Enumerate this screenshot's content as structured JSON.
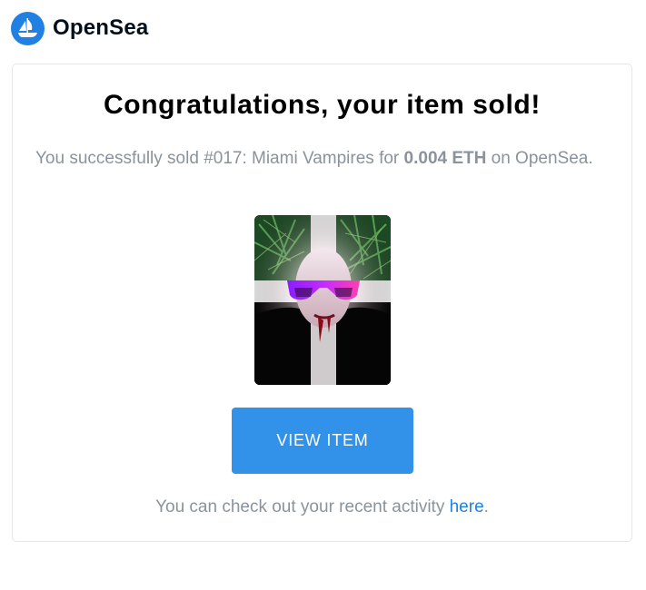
{
  "brand": {
    "name": "OpenSea",
    "icon": "opensea-logo-icon",
    "color": "#2081E2"
  },
  "email": {
    "title": "Congratulations, your item sold!",
    "message_prefix": "You successfully sold ",
    "item_name": "#017: Miami Vampires",
    "message_middle": " for ",
    "price": "0.004 ETH",
    "message_suffix": " on OpenSea.",
    "image_icon": "nft-artwork-miami-vampire",
    "button_label": "VIEW ITEM",
    "button_color": "#3291E9",
    "footer_prefix": "You can check out your recent activity ",
    "footer_link": "here",
    "footer_suffix": ".",
    "text_color": "#8a939b"
  }
}
